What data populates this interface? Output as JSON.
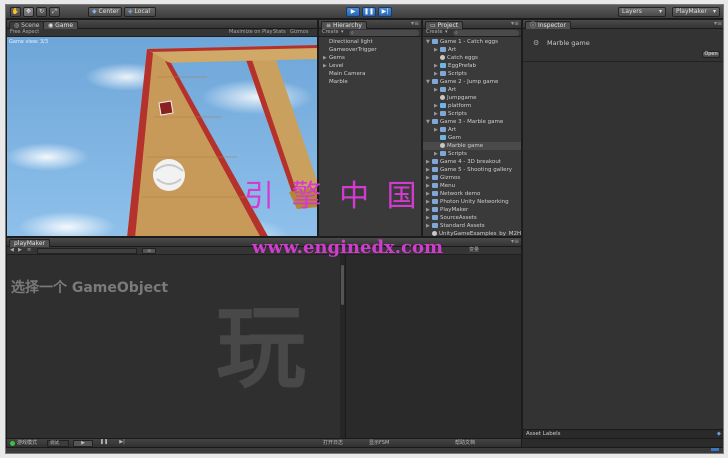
{
  "toolbar": {
    "pivot_label": "Center",
    "space_label": "Local",
    "layers_label": "Layers",
    "layout_label": "PlayMaker"
  },
  "scene_panel": {
    "tab_scene": "Scene",
    "tab_game": "Game",
    "aspect_label": "Free Aspect",
    "maximize_label": "Maximize on Play",
    "stats_label": "Stats",
    "gizmos_label": "Gizmos",
    "view_label": "Game view: 3/3"
  },
  "hierarchy": {
    "tab_label": "Hierarchy",
    "create_label": "Create",
    "items": [
      "Directional light",
      "GameoverTrigger",
      "Gems",
      "Level",
      "Main Camera",
      "Marble"
    ]
  },
  "project": {
    "tab_label": "Project",
    "create_label": "Create",
    "items": [
      {
        "label": "Game 1 - Catch eggs",
        "indent": 0,
        "type": "folder",
        "fold": "▼"
      },
      {
        "label": "Art",
        "indent": 1,
        "type": "folder",
        "fold": "▶"
      },
      {
        "label": "Catch eggs",
        "indent": 1,
        "type": "scene",
        "fold": ""
      },
      {
        "label": "EggPrefab",
        "indent": 1,
        "type": "prefab",
        "fold": "▶"
      },
      {
        "label": "Scripts",
        "indent": 1,
        "type": "folder",
        "fold": "▶"
      },
      {
        "label": "Game 2 - Jump game",
        "indent": 0,
        "type": "folder",
        "fold": "▼"
      },
      {
        "label": "Art",
        "indent": 1,
        "type": "folder",
        "fold": "▶"
      },
      {
        "label": "Jumpgame",
        "indent": 1,
        "type": "scene",
        "fold": ""
      },
      {
        "label": "platform",
        "indent": 1,
        "type": "prefab",
        "fold": "▶"
      },
      {
        "label": "Scripts",
        "indent": 1,
        "type": "folder",
        "fold": "▶"
      },
      {
        "label": "Game 3 - Marble game",
        "indent": 0,
        "type": "folder",
        "fold": "▼"
      },
      {
        "label": "Art",
        "indent": 1,
        "type": "folder",
        "fold": "▶"
      },
      {
        "label": "Gem",
        "indent": 1,
        "type": "prefab",
        "fold": ""
      },
      {
        "label": "Marble game",
        "indent": 1,
        "type": "scene",
        "fold": "",
        "selected": true
      },
      {
        "label": "Scripts",
        "indent": 1,
        "type": "folder",
        "fold": "▶"
      },
      {
        "label": "Game 4 - 3D breakout",
        "indent": 0,
        "type": "folder",
        "fold": "▶"
      },
      {
        "label": "Game 5 - Shooting gallery",
        "indent": 0,
        "type": "folder",
        "fold": "▶"
      },
      {
        "label": "Gizmos",
        "indent": 0,
        "type": "folder",
        "fold": "▶"
      },
      {
        "label": "Menu",
        "indent": 0,
        "type": "folder",
        "fold": "▶"
      },
      {
        "label": "Network demo",
        "indent": 0,
        "type": "folder",
        "fold": "▶"
      },
      {
        "label": "Photon Unity Networking",
        "indent": 0,
        "type": "folder",
        "fold": "▶"
      },
      {
        "label": "PlayMaker",
        "indent": 0,
        "type": "folder",
        "fold": "▶"
      },
      {
        "label": "SourceAssets",
        "indent": 0,
        "type": "folder",
        "fold": "▶"
      },
      {
        "label": "Standard Assets",
        "indent": 0,
        "type": "folder",
        "fold": "▶"
      },
      {
        "label": "UnityGameExamples_by_M2H",
        "indent": 0,
        "type": "scene",
        "fold": ""
      }
    ]
  },
  "inspector": {
    "tab_label": "Inspector",
    "object_name": "Marble game",
    "open_label": "Open",
    "asset_labels": "Asset Labels"
  },
  "playmaker": {
    "tab_label": "playMaker",
    "prompt_text": "选择一个 GameObject",
    "right_header": "变量",
    "bottom_left": "游戏模式",
    "debug_label": "调试",
    "bottom_mid1": "打开日志",
    "bottom_mid2": "显示FSM",
    "bottom_right": "帮助文档"
  },
  "overlays": {
    "cn_title": "引 擎 中 国",
    "url": "www.enginedx.com",
    "big_char": "玩"
  },
  "colors": {
    "accent_blue": "#3a74c4",
    "watermark_magenta": "#d23bd0",
    "sky": "#7fb3e3",
    "wood": "#c89a5a"
  }
}
